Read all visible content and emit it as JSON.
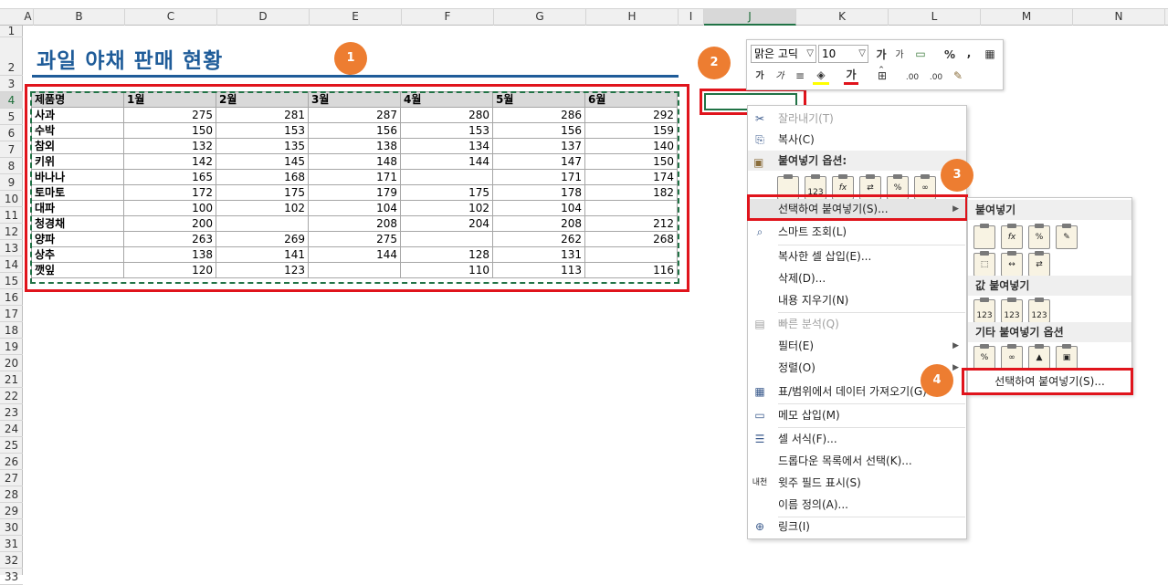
{
  "columns": [
    "A",
    "B",
    "C",
    "D",
    "E",
    "F",
    "G",
    "H",
    "I",
    "J",
    "K",
    "L",
    "M",
    "N"
  ],
  "rows": [
    "1",
    "2",
    "3",
    "4",
    "5",
    "6",
    "7",
    "8",
    "9",
    "10",
    "11",
    "12",
    "13",
    "14",
    "15",
    "16",
    "17",
    "18",
    "19",
    "20",
    "21",
    "22",
    "23",
    "24",
    "25",
    "26",
    "27",
    "28",
    "29",
    "30",
    "31",
    "32",
    "33"
  ],
  "sheet": {
    "title": "과일 야채 판매 현황",
    "header": [
      "제품명",
      "1월",
      "2월",
      "3월",
      "4월",
      "5월",
      "6월"
    ],
    "data": [
      [
        "사과",
        "275",
        "281",
        "287",
        "280",
        "286",
        "292"
      ],
      [
        "수박",
        "150",
        "153",
        "156",
        "153",
        "156",
        "159"
      ],
      [
        "참외",
        "132",
        "135",
        "138",
        "134",
        "137",
        "140"
      ],
      [
        "키위",
        "142",
        "145",
        "148",
        "144",
        "147",
        "150"
      ],
      [
        "바나나",
        "165",
        "168",
        "171",
        "",
        "171",
        "174"
      ],
      [
        "토마토",
        "172",
        "175",
        "179",
        "175",
        "178",
        "182"
      ],
      [
        "대파",
        "100",
        "102",
        "104",
        "102",
        "104",
        ""
      ],
      [
        "청경채",
        "200",
        "",
        "208",
        "204",
        "208",
        "212"
      ],
      [
        "양파",
        "263",
        "269",
        "275",
        "",
        "262",
        "268"
      ],
      [
        "상추",
        "138",
        "141",
        "144",
        "128",
        "131",
        ""
      ],
      [
        "깻잎",
        "120",
        "123",
        "",
        "110",
        "113",
        "116"
      ]
    ]
  },
  "badges": [
    "1",
    "2",
    "3",
    "4"
  ],
  "mini_toolbar": {
    "font": "맑은 고딕",
    "size": "10",
    "grow": "가",
    "shrink": "가",
    "percent": "%",
    "comma": ",",
    "bold": "가",
    "italic": "가",
    "font_color": "가",
    "inc_decimal": ".00",
    "dec_decimal": ".00"
  },
  "context_menu": {
    "cut": "잘라내기(T)",
    "copy": "복사(C)",
    "paste_options": "붙여넣기 옵션:",
    "paste_special": "선택하여 붙여넣기(S)...",
    "smart_lookup": "스마트 조회(L)",
    "insert_copied": "복사한 셀 삽입(E)...",
    "delete": "삭제(D)...",
    "clear": "내용 지우기(N)",
    "quick_analysis": "빠른 분석(Q)",
    "filter": "필터(E)",
    "sort": "정렬(O)",
    "get_data": "표/범위에서 데이터 가져오기(G)",
    "insert_comment": "메모 삽입(M)",
    "format_cells": "셀 서식(F)...",
    "pick_list": "드롭다운 목록에서 선택(K)...",
    "phonetic": "윗주 필드 표시(S)",
    "define_name": "이름 정의(A)...",
    "link": "링크(I)",
    "phonetic_icon": "내천"
  },
  "submenu": {
    "paste": "붙여넣기",
    "paste_values": "값 붙여넣기",
    "other_paste": "기타 붙여넣기 옵션",
    "paste_special": "선택하여 붙여넣기(S)..."
  },
  "paste_labels": {
    "values": "123",
    "formula": "fx",
    "percent": "%"
  },
  "colors": {
    "accent": "#1f5c99",
    "red": "#e0141c",
    "badge": "#ed7d31",
    "excel_green": "#217346"
  }
}
